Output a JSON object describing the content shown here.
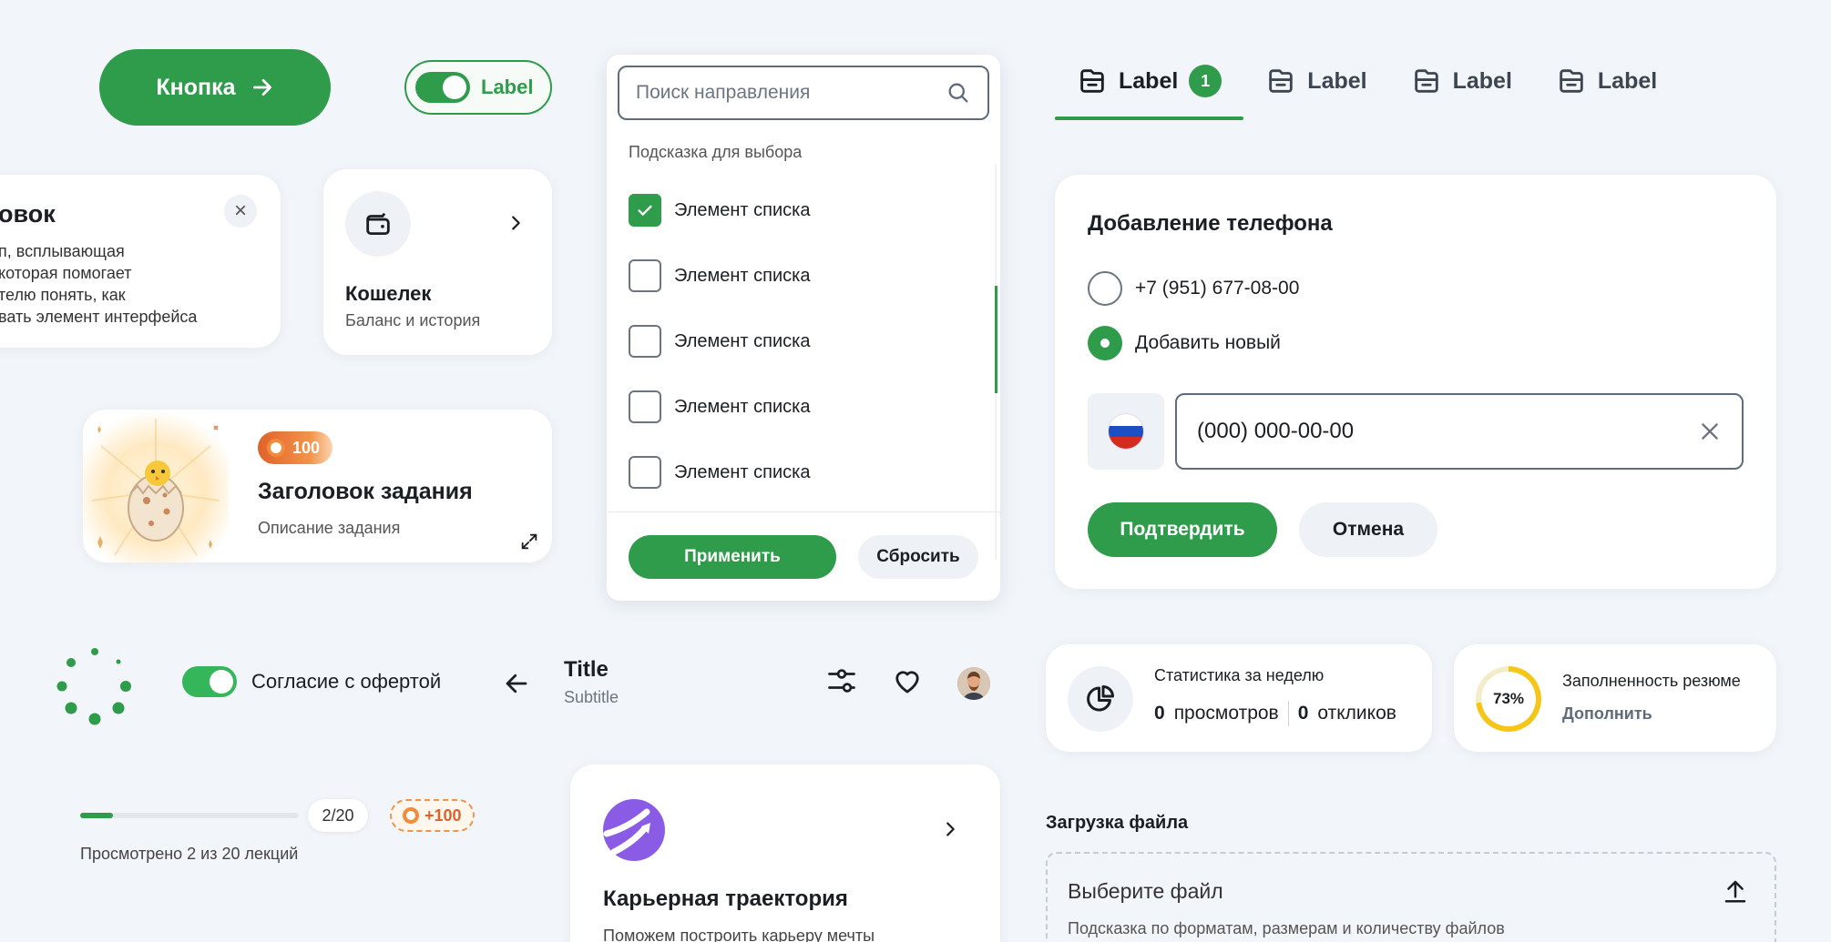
{
  "primary_button": {
    "label": "Кнопка",
    "icon": "arrow-right-icon"
  },
  "toggle_pill": {
    "label": "Label",
    "on": true
  },
  "tooltip": {
    "title": "овок",
    "body": "п, всплывающая\n которая помогает\nтелю понять, как\nвать элемент интерфейса"
  },
  "wallet": {
    "title": "Кошелек",
    "subtitle": "Баланс и история",
    "icon": "wallet-icon"
  },
  "task": {
    "coins": "100",
    "title": "Заголовок задания",
    "description": "Описание задания"
  },
  "dropdown": {
    "search_placeholder": "Поиск направления",
    "hint": "Подсказка для выбора",
    "items": [
      {
        "label": "Элемент списка",
        "checked": true
      },
      {
        "label": "Элемент списка",
        "checked": false
      },
      {
        "label": "Элемент списка",
        "checked": false
      },
      {
        "label": "Элемент списка",
        "checked": false
      },
      {
        "label": "Элемент списка",
        "checked": false
      }
    ],
    "apply": "Применить",
    "reset": "Сбросить"
  },
  "tabs": [
    {
      "label": "Label",
      "badge": "1",
      "active": true
    },
    {
      "label": "Label",
      "active": false
    },
    {
      "label": "Label",
      "active": false
    },
    {
      "label": "Label",
      "active": false
    }
  ],
  "phone_form": {
    "title": "Добавление телефона",
    "options": [
      {
        "label": "+7 (951) 677-08-00",
        "selected": false
      },
      {
        "label": "Добавить новый",
        "selected": true
      }
    ],
    "input_placeholder": "(000) 000-00-00",
    "confirm": "Подтвердить",
    "cancel": "Отмена"
  },
  "consent": {
    "label": "Согласие с офертой",
    "on": true
  },
  "title_bar": {
    "title": "Title",
    "subtitle": "Subtitle"
  },
  "progress": {
    "value": 2,
    "total": 20,
    "count_label": "2/20",
    "reward": "+100",
    "caption": "Просмотрено 2 из 20 лекций"
  },
  "career": {
    "title": "Карьерная траектория",
    "description": "Поможем построить карьеру мечты"
  },
  "stats": {
    "title": "Статистика за неделю",
    "views_count": "0",
    "views_label": "просмотров",
    "responses_count": "0",
    "responses_label": "откликов"
  },
  "resume": {
    "title": "Заполненность резюме",
    "percent_label": "73%",
    "percent": 73,
    "link": "Дополнить"
  },
  "upload": {
    "label": "Загрузка файла",
    "title": "Выберите файл",
    "hint": "Подсказка по форматам, размерам и количеству файлов"
  },
  "colors": {
    "primary": "#2e9c4a",
    "accent_orange": "#f2944a",
    "progress_yellow": "#f5c518",
    "career_purple": "#8a5ce6"
  }
}
